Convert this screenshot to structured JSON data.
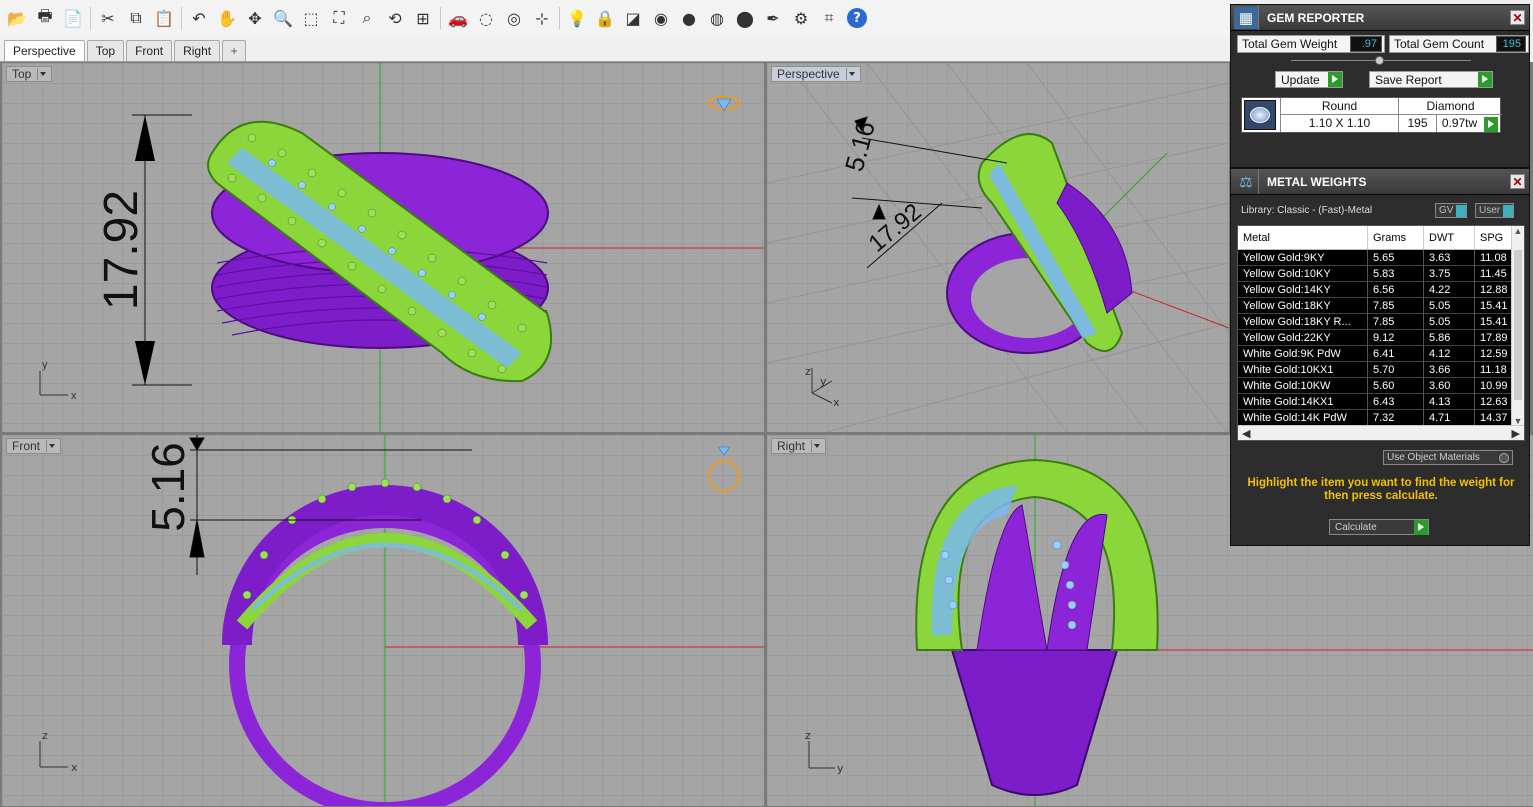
{
  "toolbar": {
    "buttons": [
      {
        "name": "open-file-icon",
        "glyph": "📂"
      },
      {
        "name": "print-icon",
        "glyph": "🖶"
      },
      {
        "name": "properties-icon",
        "glyph": "📄"
      },
      {
        "name": "cut-icon",
        "glyph": "✂"
      },
      {
        "name": "copy-icon",
        "glyph": "⧉"
      },
      {
        "name": "paste-icon",
        "glyph": "📋"
      },
      {
        "name": "undo-icon",
        "glyph": "↶"
      },
      {
        "name": "pan-hand-icon",
        "glyph": "✋"
      },
      {
        "name": "rotate-view-icon",
        "glyph": "✥"
      },
      {
        "name": "zoom-icon",
        "glyph": "🔍"
      },
      {
        "name": "zoom-window-icon",
        "glyph": "⬚"
      },
      {
        "name": "zoom-extents-icon",
        "glyph": "⛶"
      },
      {
        "name": "zoom-selected-icon",
        "glyph": "⌕"
      },
      {
        "name": "undo-view-icon",
        "glyph": "⟲"
      },
      {
        "name": "four-viewports-icon",
        "glyph": "⊞"
      },
      {
        "name": "car-icon",
        "glyph": "🚗"
      },
      {
        "name": "hide-objects-icon",
        "glyph": "◌"
      },
      {
        "name": "show-objects-icon",
        "glyph": "◎"
      },
      {
        "name": "osnap-icon",
        "glyph": "⊹"
      },
      {
        "name": "light-bulb-icon",
        "glyph": "💡"
      },
      {
        "name": "lock-icon",
        "glyph": "🔒"
      },
      {
        "name": "layer-icon",
        "glyph": "◪"
      },
      {
        "name": "color-wheel-icon",
        "glyph": "◉"
      },
      {
        "name": "render-sphere-icon",
        "glyph": "●"
      },
      {
        "name": "shaded-sphere-icon",
        "glyph": "◍"
      },
      {
        "name": "blue-sphere-icon",
        "glyph": "⬤"
      },
      {
        "name": "pen-icon",
        "glyph": "✒"
      },
      {
        "name": "settings-gear-icon",
        "glyph": "⚙"
      },
      {
        "name": "dimension-icon",
        "glyph": "⌗"
      },
      {
        "name": "help-icon",
        "glyph": "?"
      }
    ]
  },
  "tabs": [
    {
      "label": "Perspective",
      "active": true
    },
    {
      "label": "Top",
      "active": false
    },
    {
      "label": "Front",
      "active": false
    },
    {
      "label": "Right",
      "active": false
    },
    {
      "label": "+",
      "active": false
    }
  ],
  "viewports": {
    "top": {
      "label": "Top",
      "dimension": "17.92",
      "axis1": "y",
      "axis2": "x"
    },
    "perspective": {
      "label": "Perspective",
      "dim1": "5.16",
      "dim2": "17.92",
      "axis1": "z",
      "axis2": "y",
      "axis3": "x"
    },
    "front": {
      "label": "Front",
      "dimension": "5.16",
      "axis1": "z",
      "axis2": "x"
    },
    "right": {
      "label": "Right",
      "axis1": "z",
      "axis2": "y"
    }
  },
  "gem_reporter": {
    "title": "GEM REPORTER",
    "total_weight_label": "Total Gem Weight",
    "total_weight_value": ".97",
    "total_count_label": "Total Gem Count",
    "total_count_value": "195",
    "update_label": "Update",
    "save_label": "Save Report",
    "gem": {
      "shape": "Round",
      "type": "Diamond",
      "size": "1.10 X 1.10",
      "count": "195",
      "weight": "0.97tw"
    }
  },
  "metal_weights": {
    "title": "METAL WEIGHTS",
    "library": "Library: Classic - (Fast)-Metal",
    "toggle_gv": "GV",
    "toggle_user": "User",
    "columns": [
      "Metal",
      "Grams",
      "DWT",
      "SPG"
    ],
    "rows": [
      [
        "Yellow Gold:9KY",
        "5.65",
        "3.63",
        "11.08"
      ],
      [
        "Yellow Gold:10KY",
        "5.83",
        "3.75",
        "11.45"
      ],
      [
        "Yellow Gold:14KY",
        "6.56",
        "4.22",
        "12.88"
      ],
      [
        "Yellow Gold:18KY",
        "7.85",
        "5.05",
        "15.41"
      ],
      [
        "Yellow Gold:18KY R...",
        "7.85",
        "5.05",
        "15.41"
      ],
      [
        "Yellow Gold:22KY",
        "9.12",
        "5.86",
        "17.89"
      ],
      [
        "White Gold:9K PdW",
        "6.41",
        "4.12",
        "12.59"
      ],
      [
        "White Gold:10KX1",
        "5.70",
        "3.66",
        "11.18"
      ],
      [
        "White Gold:10KW",
        "5.60",
        "3.60",
        "10.99"
      ],
      [
        "White Gold:14KX1",
        "6.43",
        "4.13",
        "12.63"
      ],
      [
        "White Gold:14K PdW",
        "7.32",
        "4.71",
        "14.37"
      ]
    ],
    "use_object_materials": "Use Object Materials",
    "instruction": "Highlight the item you want to find the weight for then press calculate.",
    "calculate_label": "Calculate"
  },
  "colors": {
    "accent_green": "#7ed321",
    "ring_purple": "#8a1fd6",
    "gem_blue": "#7ab8f0",
    "axis_red": "#c22",
    "axis_green": "#2a2",
    "instruction_yellow": "#f2c200"
  }
}
